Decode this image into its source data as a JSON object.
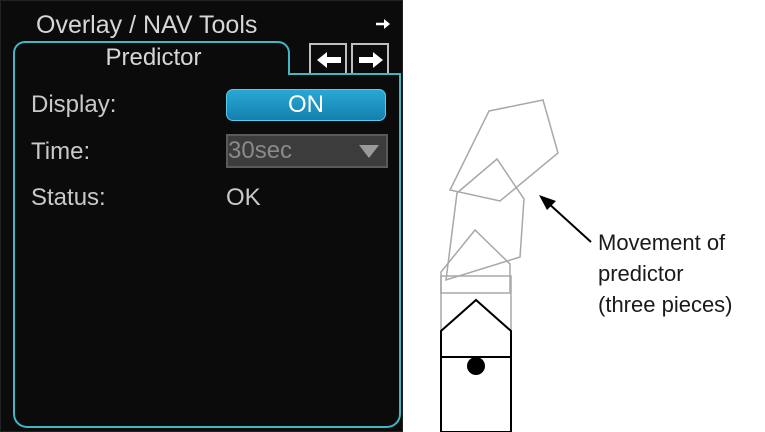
{
  "window": {
    "title": "Overlay / NAV Tools",
    "title_arrow_icon": "right-arrow-icon"
  },
  "tabs": {
    "active_label": "Predictor",
    "prev_icon": "left-arrow-icon",
    "next_icon": "right-arrow-icon"
  },
  "fields": {
    "display_label": "Display:",
    "display_value": "ON",
    "time_label": "Time:",
    "time_value": "30sec",
    "status_label": "Status:",
    "status_value": "OK"
  },
  "illustration": {
    "caption_lines": [
      "Movement of",
      "predictor",
      "(three pieces)"
    ]
  },
  "colors": {
    "panel_bg": "#0b0b0b",
    "accent_border": "#3fb7c4",
    "on_button": "#1f9ccc",
    "disabled_select": "#3c3c3c"
  }
}
